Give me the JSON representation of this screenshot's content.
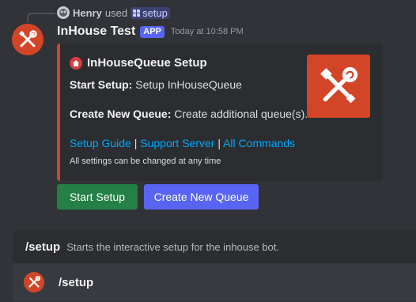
{
  "reply": {
    "user": "Henry",
    "action": "used",
    "command": "setup"
  },
  "message": {
    "bot_name": "InHouse Test",
    "badge": "APP",
    "timestamp": "Today at 10:58 PM"
  },
  "embed": {
    "title": "InHouseQueue Setup",
    "field1_label": "Start Setup:",
    "field1_value": " Setup InHouseQueue",
    "field2_label": "Create New Queue:",
    "field2_value": " Create additional queue(s).",
    "link1": "Setup Guide",
    "link2": "Support Server",
    "link3": "All Commands",
    "separator": " | ",
    "note": "All settings can be changed at any time",
    "accent_color": "#d34527"
  },
  "buttons": {
    "start_setup": "Start Setup",
    "create_queue": "Create New Queue"
  },
  "command_bar": {
    "command": "/setup",
    "description": "Starts the interactive setup for the inhouse bot.",
    "input_value": "/setup"
  }
}
